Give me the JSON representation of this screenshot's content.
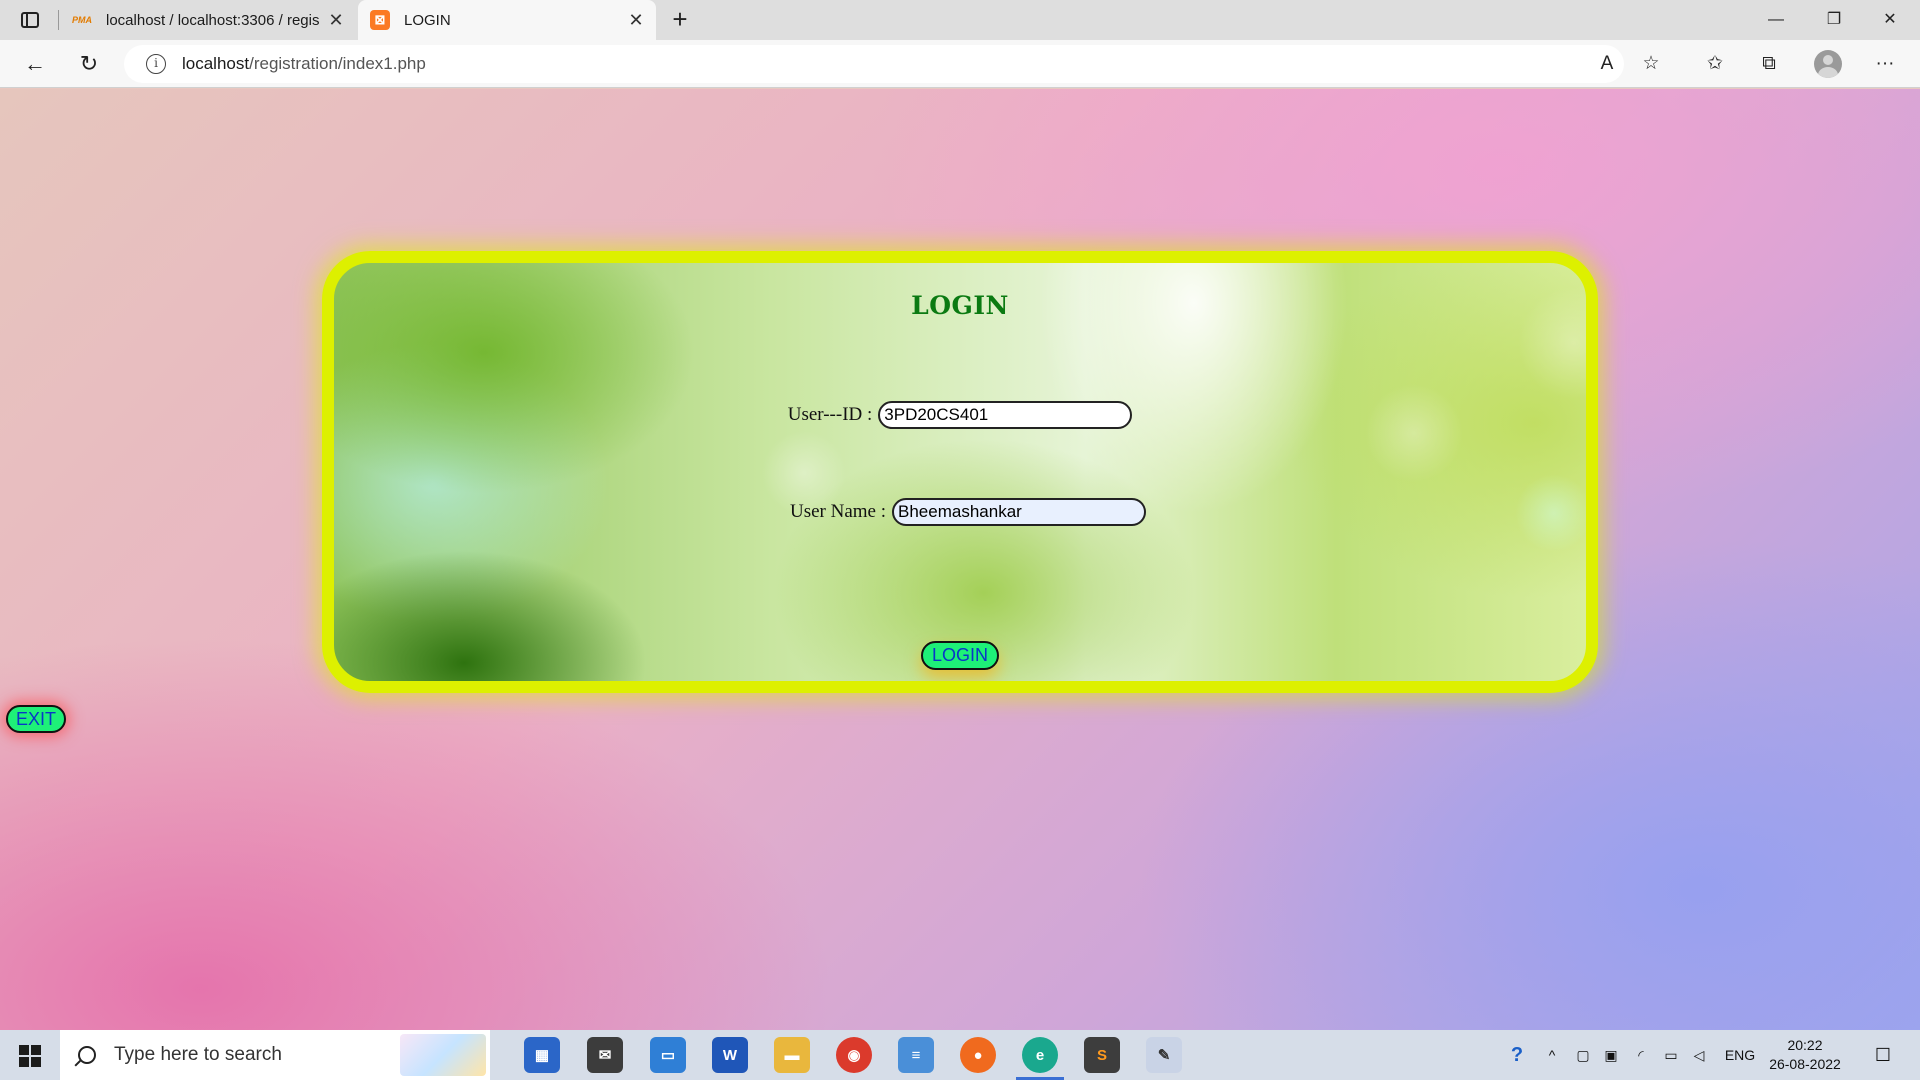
{
  "browser": {
    "tabs": [
      {
        "title": "localhost / localhost:3306 / regis",
        "icon": "phpmyadmin-icon",
        "favicon_text": "PMA"
      },
      {
        "title": "LOGIN",
        "icon": "xampp-icon",
        "favicon_text": "⊠"
      }
    ],
    "url_host": "localhost",
    "url_path": "/registration/index1.php",
    "controls": {
      "minimize": "—",
      "restore": "❐",
      "close": "✕",
      "new_tab": "+",
      "tab_close": "✕"
    },
    "nav": {
      "back": "←",
      "reload": "↻",
      "info": "i",
      "read_aloud": "A",
      "add_favorite": "☆",
      "favorites": "✩",
      "collections": "⧉",
      "more": "···"
    }
  },
  "page": {
    "heading": "LOGIN",
    "userid_label": "User---ID :",
    "userid_value": "3PD20CS401",
    "username_label": "User Name :",
    "username_value": "Bheemashankar",
    "login_button": "LOGIN",
    "exit_button": "EXIT"
  },
  "colors": {
    "panel_border": "#ddf000",
    "heading": "#0b7a12",
    "button_bg": "#1ef078",
    "button_text": "#0a36c8"
  },
  "taskbar": {
    "search_placeholder": "Type here to search",
    "apps": [
      {
        "name": "microsoft-store-icon",
        "glyph": "▦"
      },
      {
        "name": "mail-icon",
        "glyph": "✉"
      },
      {
        "name": "this-pc-icon",
        "glyph": "▭"
      },
      {
        "name": "word-icon",
        "glyph": "W"
      },
      {
        "name": "file-explorer-icon",
        "glyph": "▬"
      },
      {
        "name": "chrome-icon",
        "glyph": "◉"
      },
      {
        "name": "notes-icon",
        "glyph": "≡"
      },
      {
        "name": "firefox-icon",
        "glyph": "●"
      },
      {
        "name": "edge-icon",
        "glyph": "e"
      },
      {
        "name": "sublime-text-icon",
        "glyph": "S"
      },
      {
        "name": "paint-icon",
        "glyph": "✎"
      }
    ],
    "tray": {
      "help": "?",
      "chevron": "^",
      "language": "ENG",
      "time": "20:22",
      "date": "26-08-2022"
    }
  }
}
